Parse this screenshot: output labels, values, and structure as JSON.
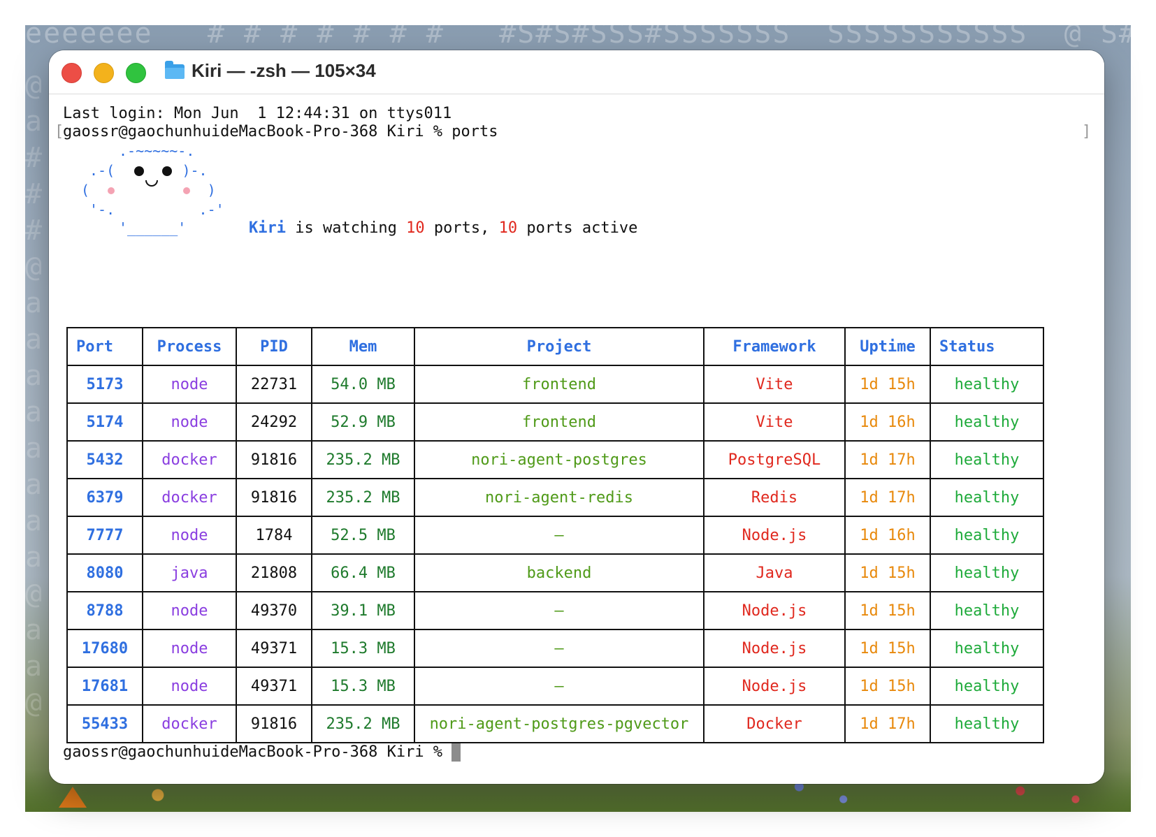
{
  "window": {
    "title": "Kiri — -zsh — 105×34"
  },
  "terminal": {
    "last_login": "Last login: Mon Jun  1 12:44:31 on ttys011",
    "prompt_command": "gaossr@gaochunhuideMacBook-Pro-368 Kiri % ports",
    "final_prompt": "gaossr@gaochunhuideMacBook-Pro-368 Kiri %",
    "open_bracket": "[",
    "close_bracket": "]"
  },
  "mascot": {
    "line1": ".-~~~~~-.",
    "line2": ".-(        )-.",
    "line3": "(              )",
    "line4": "'-.          .-'",
    "line5": "'______'"
  },
  "summary": {
    "name": "Kiri",
    "is_watching": " is watching ",
    "watching_count": "10",
    "ports_mid": " ports, ",
    "active_count": "10",
    "ports_end": " ports active"
  },
  "table": {
    "headers": [
      "Port",
      "Process",
      "PID",
      "Mem",
      "Project",
      "Framework",
      "Uptime",
      "Status"
    ],
    "rows": [
      {
        "port": "5173",
        "process": "node",
        "pid": "22731",
        "mem": "54.0 MB",
        "project": "frontend",
        "framework": "Vite",
        "uptime": "1d 15h",
        "status": "healthy"
      },
      {
        "port": "5174",
        "process": "node",
        "pid": "24292",
        "mem": "52.9 MB",
        "project": "frontend",
        "framework": "Vite",
        "uptime": "1d 16h",
        "status": "healthy"
      },
      {
        "port": "5432",
        "process": "docker",
        "pid": "91816",
        "mem": "235.2 MB",
        "project": "nori-agent-postgres",
        "framework": "PostgreSQL",
        "uptime": "1d 17h",
        "status": "healthy"
      },
      {
        "port": "6379",
        "process": "docker",
        "pid": "91816",
        "mem": "235.2 MB",
        "project": "nori-agent-redis",
        "framework": "Redis",
        "uptime": "1d 17h",
        "status": "healthy"
      },
      {
        "port": "7777",
        "process": "node",
        "pid": "1784",
        "mem": "52.5 MB",
        "project": "–",
        "framework": "Node.js",
        "uptime": "1d 16h",
        "status": "healthy"
      },
      {
        "port": "8080",
        "process": "java",
        "pid": "21808",
        "mem": "66.4 MB",
        "project": "backend",
        "framework": "Java",
        "uptime": "1d 15h",
        "status": "healthy"
      },
      {
        "port": "8788",
        "process": "node",
        "pid": "49370",
        "mem": "39.1 MB",
        "project": "–",
        "framework": "Node.js",
        "uptime": "1d 15h",
        "status": "healthy"
      },
      {
        "port": "17680",
        "process": "node",
        "pid": "49371",
        "mem": "15.3 MB",
        "project": "–",
        "framework": "Node.js",
        "uptime": "1d 15h",
        "status": "healthy"
      },
      {
        "port": "17681",
        "process": "node",
        "pid": "49371",
        "mem": "15.3 MB",
        "project": "–",
        "framework": "Node.js",
        "uptime": "1d 15h",
        "status": "healthy"
      },
      {
        "port": "55433",
        "process": "docker",
        "pid": "91816",
        "mem": "235.2 MB",
        "project": "nori-agent-postgres-pgvector",
        "framework": "Docker",
        "uptime": "1d 17h",
        "status": "healthy"
      }
    ]
  },
  "colors": {
    "accent_blue": "#2f6fe0",
    "process_purple": "#8a3ee0",
    "memory_green": "#1e7a2c",
    "project_green": "#4f9a18",
    "framework_red": "#e0281e",
    "uptime_orange": "#e8890c",
    "status_green": "#1eaa3a"
  },
  "icons": {
    "titlebar": "folder-icon",
    "close": "close-light-icon",
    "minimize": "minimize-light-icon",
    "zoom": "zoom-light-icon"
  }
}
